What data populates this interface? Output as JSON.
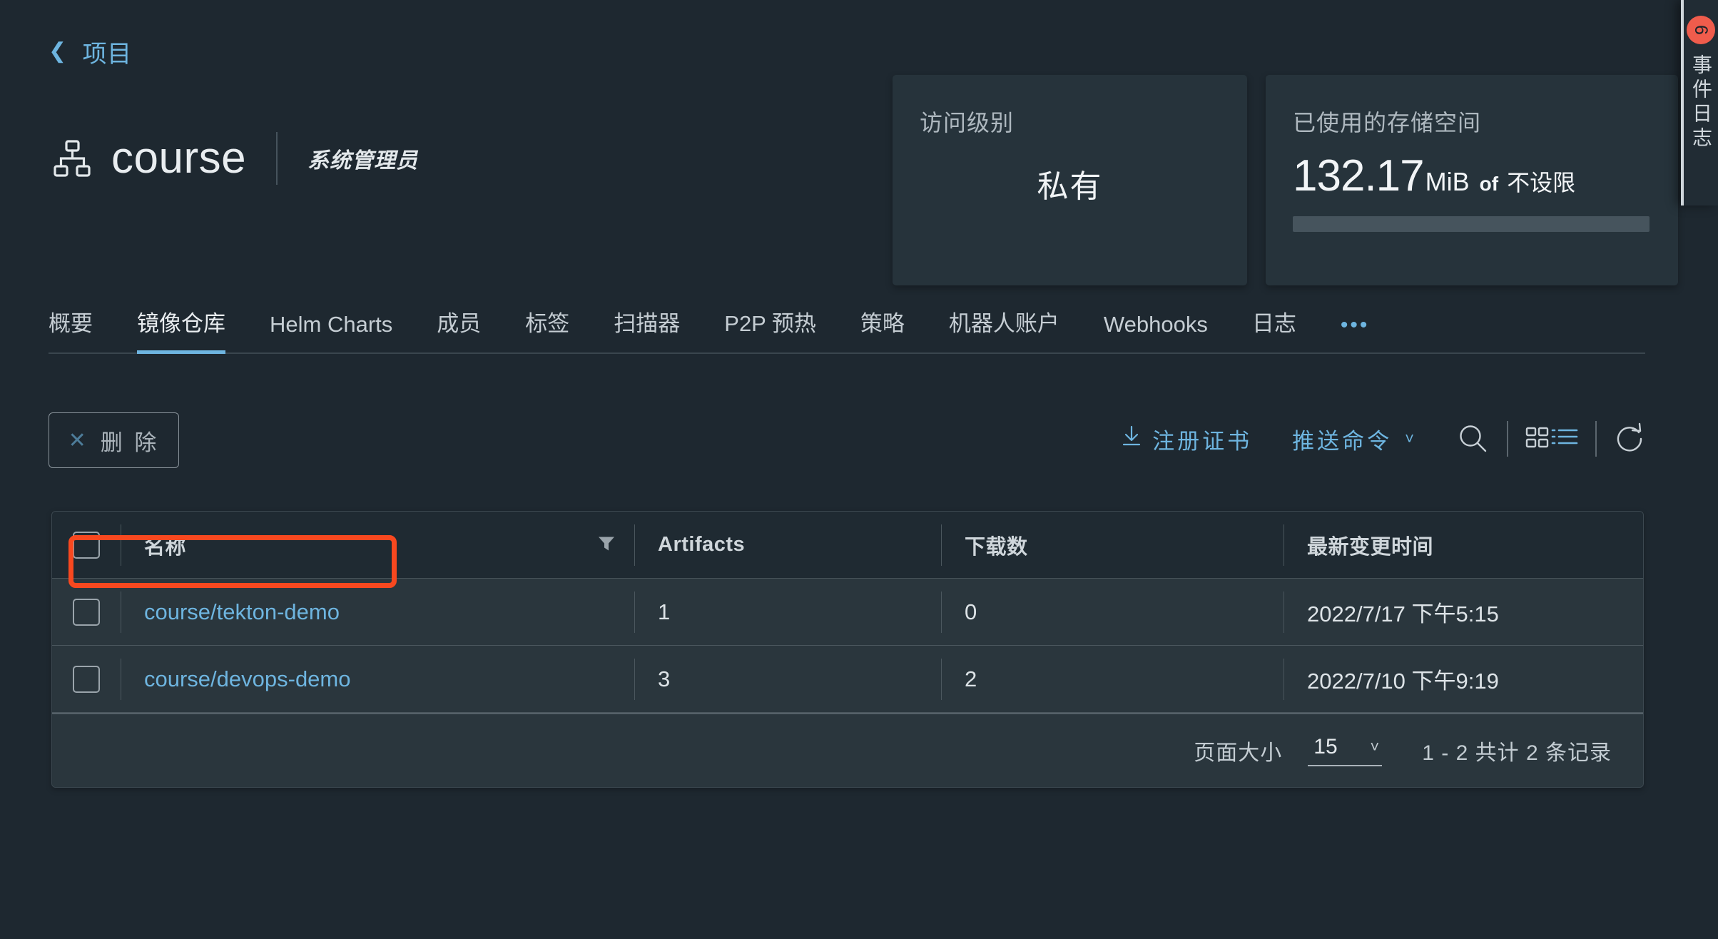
{
  "breadcrumb": {
    "icon": "chevron-left-icon",
    "label": "项目"
  },
  "project": {
    "icon": "hierarchy-icon",
    "name": "course",
    "role": "系统管理员"
  },
  "cards": {
    "access": {
      "title": "访问级别",
      "value": "私有"
    },
    "storage": {
      "title": "已使用的存储空间",
      "used_number": "132.17",
      "used_unit": "MiB",
      "of": "of",
      "limit": "不设限",
      "progress_percent": 0
    }
  },
  "event_log_tab": {
    "label": "事件日志",
    "badge": "6"
  },
  "tabs": [
    {
      "label": "概要",
      "active": false
    },
    {
      "label": "镜像仓库",
      "active": true
    },
    {
      "label": "Helm Charts",
      "active": false
    },
    {
      "label": "成员",
      "active": false
    },
    {
      "label": "标签",
      "active": false
    },
    {
      "label": "扫描器",
      "active": false
    },
    {
      "label": "P2P 预热",
      "active": false
    },
    {
      "label": "策略",
      "active": false
    },
    {
      "label": "机器人账户",
      "active": false
    },
    {
      "label": "Webhooks",
      "active": false
    },
    {
      "label": "日志",
      "active": false
    },
    {
      "label": "•••",
      "active": false
    }
  ],
  "toolbar": {
    "delete_label": "删 除",
    "delete_icon": "close-x-icon",
    "registry_cert_label": "注册证书",
    "registry_cert_icon": "download-icon",
    "push_command_label": "推送命令",
    "push_command_caret": "chevron-down-icon",
    "search_icon": "search-icon",
    "grid_view_icon": "grid-view-icon",
    "list_view_icon": "list-view-icon",
    "refresh_icon": "refresh-icon"
  },
  "table": {
    "columns": [
      "名称",
      "Artifacts",
      "下载数",
      "最新变更时间"
    ],
    "filter_icon": "filter-icon",
    "rows": [
      {
        "name": "course/tekton-demo",
        "artifacts": "1",
        "downloads": "0",
        "updated": "2022/7/17 下午5:15",
        "highlighted": true
      },
      {
        "name": "course/devops-demo",
        "artifacts": "3",
        "downloads": "2",
        "updated": "2022/7/10 下午9:19",
        "highlighted": false
      }
    ]
  },
  "pagination": {
    "page_size_label": "页面大小",
    "page_size_value": "15",
    "caret_icon": "chevron-down-icon",
    "total_label": "1 - 2 共计 2 条记录"
  },
  "colors": {
    "background": "#1e2830",
    "card": "#26333b",
    "accent": "#6eb5e0",
    "annotation": "#f8481f",
    "badge": "#ef5c4c",
    "row": "#2a363d"
  }
}
